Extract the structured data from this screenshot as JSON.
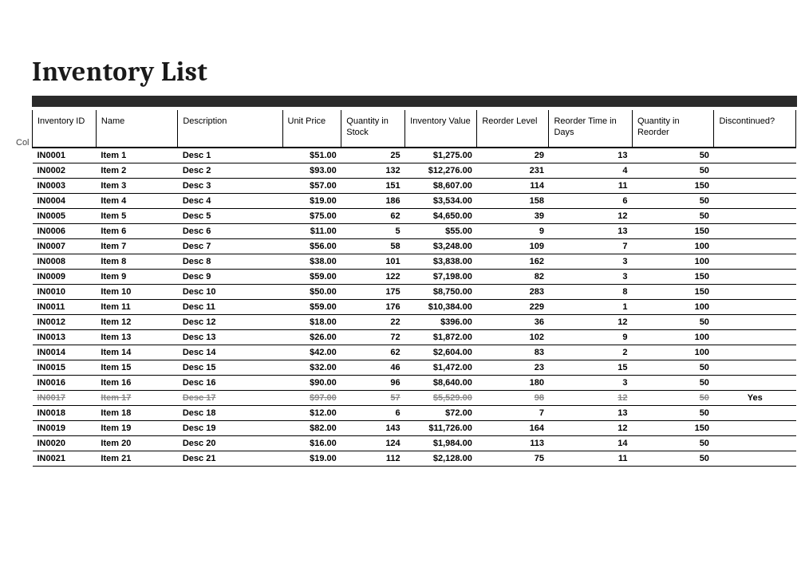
{
  "title": "Inventory List",
  "side_label": "Col",
  "headers": {
    "id": "Inventory ID",
    "name": "Name",
    "desc": "Description",
    "price": "Unit Price",
    "qty": "Quantity in Stock",
    "val": "Inventory Value",
    "re": "Reorder Level",
    "rt": "Reorder Time in Days",
    "qr": "Quantity in Reorder",
    "disc": "Discontinued?"
  },
  "rows": [
    {
      "id": "IN0001",
      "name": "Item 1",
      "desc": "Desc 1",
      "price": "$51.00",
      "qty": "25",
      "val": "$1,275.00",
      "re": "29",
      "rt": "13",
      "qr": "50",
      "disc": "",
      "discontinued": false
    },
    {
      "id": "IN0002",
      "name": "Item 2",
      "desc": "Desc 2",
      "price": "$93.00",
      "qty": "132",
      "val": "$12,276.00",
      "re": "231",
      "rt": "4",
      "qr": "50",
      "disc": "",
      "discontinued": false
    },
    {
      "id": "IN0003",
      "name": "Item 3",
      "desc": "Desc 3",
      "price": "$57.00",
      "qty": "151",
      "val": "$8,607.00",
      "re": "114",
      "rt": "11",
      "qr": "150",
      "disc": "",
      "discontinued": false
    },
    {
      "id": "IN0004",
      "name": "Item 4",
      "desc": "Desc 4",
      "price": "$19.00",
      "qty": "186",
      "val": "$3,534.00",
      "re": "158",
      "rt": "6",
      "qr": "50",
      "disc": "",
      "discontinued": false
    },
    {
      "id": "IN0005",
      "name": "Item 5",
      "desc": "Desc 5",
      "price": "$75.00",
      "qty": "62",
      "val": "$4,650.00",
      "re": "39",
      "rt": "12",
      "qr": "50",
      "disc": "",
      "discontinued": false
    },
    {
      "id": "IN0006",
      "name": "Item 6",
      "desc": "Desc 6",
      "price": "$11.00",
      "qty": "5",
      "val": "$55.00",
      "re": "9",
      "rt": "13",
      "qr": "150",
      "disc": "",
      "discontinued": false
    },
    {
      "id": "IN0007",
      "name": "Item 7",
      "desc": "Desc 7",
      "price": "$56.00",
      "qty": "58",
      "val": "$3,248.00",
      "re": "109",
      "rt": "7",
      "qr": "100",
      "disc": "",
      "discontinued": false
    },
    {
      "id": "IN0008",
      "name": "Item 8",
      "desc": "Desc 8",
      "price": "$38.00",
      "qty": "101",
      "val": "$3,838.00",
      "re": "162",
      "rt": "3",
      "qr": "100",
      "disc": "",
      "discontinued": false
    },
    {
      "id": "IN0009",
      "name": "Item 9",
      "desc": "Desc 9",
      "price": "$59.00",
      "qty": "122",
      "val": "$7,198.00",
      "re": "82",
      "rt": "3",
      "qr": "150",
      "disc": "",
      "discontinued": false
    },
    {
      "id": "IN0010",
      "name": "Item 10",
      "desc": "Desc 10",
      "price": "$50.00",
      "qty": "175",
      "val": "$8,750.00",
      "re": "283",
      "rt": "8",
      "qr": "150",
      "disc": "",
      "discontinued": false
    },
    {
      "id": "IN0011",
      "name": "Item 11",
      "desc": "Desc 11",
      "price": "$59.00",
      "qty": "176",
      "val": "$10,384.00",
      "re": "229",
      "rt": "1",
      "qr": "100",
      "disc": "",
      "discontinued": false
    },
    {
      "id": "IN0012",
      "name": "Item 12",
      "desc": "Desc 12",
      "price": "$18.00",
      "qty": "22",
      "val": "$396.00",
      "re": "36",
      "rt": "12",
      "qr": "50",
      "disc": "",
      "discontinued": false
    },
    {
      "id": "IN0013",
      "name": "Item 13",
      "desc": "Desc 13",
      "price": "$26.00",
      "qty": "72",
      "val": "$1,872.00",
      "re": "102",
      "rt": "9",
      "qr": "100",
      "disc": "",
      "discontinued": false
    },
    {
      "id": "IN0014",
      "name": "Item 14",
      "desc": "Desc 14",
      "price": "$42.00",
      "qty": "62",
      "val": "$2,604.00",
      "re": "83",
      "rt": "2",
      "qr": "100",
      "disc": "",
      "discontinued": false
    },
    {
      "id": "IN0015",
      "name": "Item 15",
      "desc": "Desc 15",
      "price": "$32.00",
      "qty": "46",
      "val": "$1,472.00",
      "re": "23",
      "rt": "15",
      "qr": "50",
      "disc": "",
      "discontinued": false
    },
    {
      "id": "IN0016",
      "name": "Item 16",
      "desc": "Desc 16",
      "price": "$90.00",
      "qty": "96",
      "val": "$8,640.00",
      "re": "180",
      "rt": "3",
      "qr": "50",
      "disc": "",
      "discontinued": false
    },
    {
      "id": "IN0017",
      "name": "Item 17",
      "desc": "Desc 17",
      "price": "$97.00",
      "qty": "57",
      "val": "$5,529.00",
      "re": "98",
      "rt": "12",
      "qr": "50",
      "disc": "Yes",
      "discontinued": true
    },
    {
      "id": "IN0018",
      "name": "Item 18",
      "desc": "Desc 18",
      "price": "$12.00",
      "qty": "6",
      "val": "$72.00",
      "re": "7",
      "rt": "13",
      "qr": "50",
      "disc": "",
      "discontinued": false
    },
    {
      "id": "IN0019",
      "name": "Item 19",
      "desc": "Desc 19",
      "price": "$82.00",
      "qty": "143",
      "val": "$11,726.00",
      "re": "164",
      "rt": "12",
      "qr": "150",
      "disc": "",
      "discontinued": false
    },
    {
      "id": "IN0020",
      "name": "Item 20",
      "desc": "Desc 20",
      "price": "$16.00",
      "qty": "124",
      "val": "$1,984.00",
      "re": "113",
      "rt": "14",
      "qr": "50",
      "disc": "",
      "discontinued": false
    },
    {
      "id": "IN0021",
      "name": "Item 21",
      "desc": "Desc 21",
      "price": "$19.00",
      "qty": "112",
      "val": "$2,128.00",
      "re": "75",
      "rt": "11",
      "qr": "50",
      "disc": "",
      "discontinued": false
    }
  ]
}
